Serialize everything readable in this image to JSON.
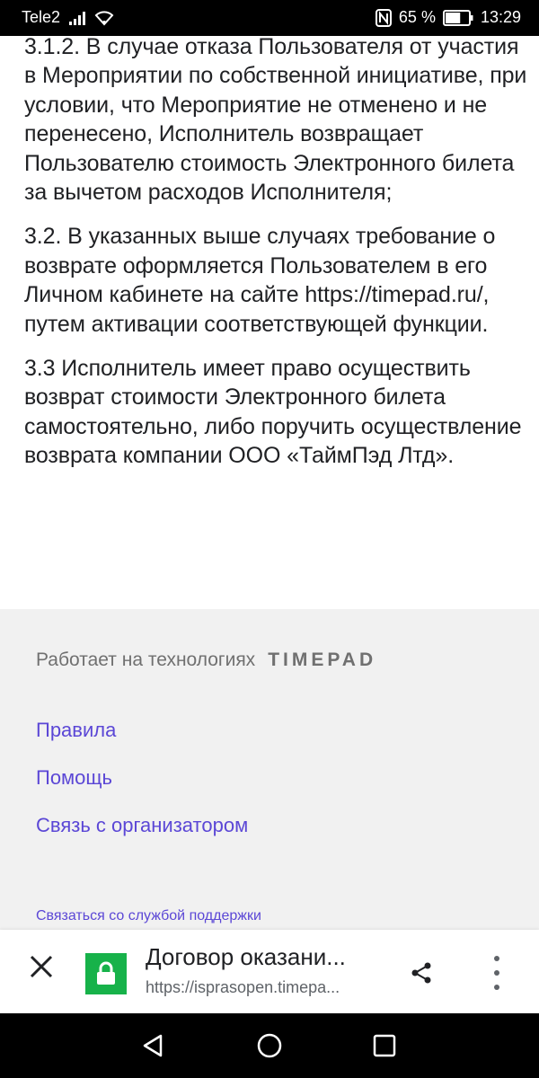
{
  "status_bar": {
    "carrier": "Tele2",
    "battery_percent": "65 %",
    "time": "13:29",
    "battery_level": 0.65
  },
  "content": {
    "paragraphs": [
      "3.1.2. В случае отказа Пользователя от участия в Мероприятии по собственной инициативе, при условии, что Мероприятие не отменено и не перенесено, Исполнитель возвращает Пользователю стоимость Электронного билета за вычетом расходов Исполнителя;",
      "3.2. В указанных выше случаях требование о возврате оформляется Пользователем в его Личном кабинете на сайте https://timepad.ru/, путем активации соответствующей функции.",
      "3.3 Исполнитель имеет право осуществить возврат стоимости Электронного билета самостоятельно, либо поручить осуществление возврата компании ООО «ТаймПэд Лтд»."
    ]
  },
  "footer": {
    "powered_by": "Работает на технологиях",
    "logo_text": "TIMEPAD",
    "links": [
      "Правила",
      "Помощь",
      "Связь с организатором"
    ],
    "support_link": "Связаться со службой поддержки"
  },
  "tab_bar": {
    "title": "Договор оказани...",
    "url": "https://isprasopen.timepa..."
  },
  "icons": {
    "close": "close-icon",
    "lock": "lock-icon",
    "share": "share-icon",
    "menu": "more-vert-icon",
    "back": "back-icon",
    "home": "home-icon",
    "recents": "recents-icon"
  },
  "colors": {
    "link": "#5b47d6",
    "footer_bg": "#f1f1f1",
    "lock_bg": "#17b24a"
  }
}
